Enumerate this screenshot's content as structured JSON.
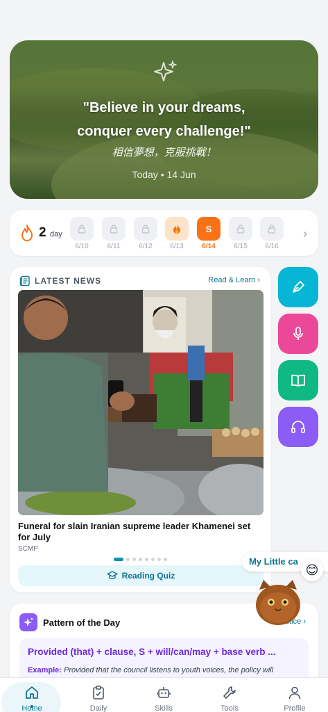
{
  "hero": {
    "quote_line1": "\"Believe in your dreams,",
    "quote_line2": "conquer every challenge!\"",
    "translation": "相信夢想，克服挑戰！",
    "date": "Today • 14 Jun"
  },
  "streak": {
    "count": "2",
    "unit": "day",
    "days": [
      {
        "label": "6/10",
        "state": "locked"
      },
      {
        "label": "6/11",
        "state": "locked"
      },
      {
        "label": "6/12",
        "state": "locked"
      },
      {
        "label": "6/13",
        "state": "fire"
      },
      {
        "label": "6/14",
        "state": "today",
        "letter": "S"
      },
      {
        "label": "6/15",
        "state": "locked"
      },
      {
        "label": "6/16",
        "state": "locked"
      }
    ]
  },
  "news": {
    "header": "LATEST NEWS",
    "read_learn": "Read & Learn",
    "title": "Funeral for slain Iranian supreme leader Khamenei set for July",
    "source": "SCMP",
    "quiz_label": "Reading Quiz",
    "page_count": 8,
    "active_page": 0
  },
  "side_actions": [
    {
      "name": "writing",
      "icon": "pen-nib-icon",
      "color": "#06b6d4"
    },
    {
      "name": "speaking",
      "icon": "microphone-icon",
      "color": "#ec4899"
    },
    {
      "name": "reading",
      "icon": "book-open-icon",
      "color": "#10b981"
    },
    {
      "name": "listening",
      "icon": "headphones-icon",
      "color": "#8b5cf6"
    }
  ],
  "assistant": {
    "bubble_text": "My Little ca",
    "emoji": "😊"
  },
  "pattern": {
    "title": "Pattern of the Day",
    "practice": "Practice",
    "formula": "Provided (that) + clause, S + will/can/may + base verb ...",
    "example_label": "Example:",
    "example_text": "Provided that the council listens to youth voices, the policy will"
  },
  "nav": {
    "items": [
      {
        "label": "Home",
        "icon": "home-icon",
        "active": true
      },
      {
        "label": "Daily",
        "icon": "clipboard-check-icon",
        "active": false
      },
      {
        "label": "Skills",
        "icon": "robot-icon",
        "active": false
      },
      {
        "label": "Tools",
        "icon": "wrench-icon",
        "active": false
      },
      {
        "label": "Profile",
        "icon": "user-icon",
        "active": false
      }
    ]
  }
}
